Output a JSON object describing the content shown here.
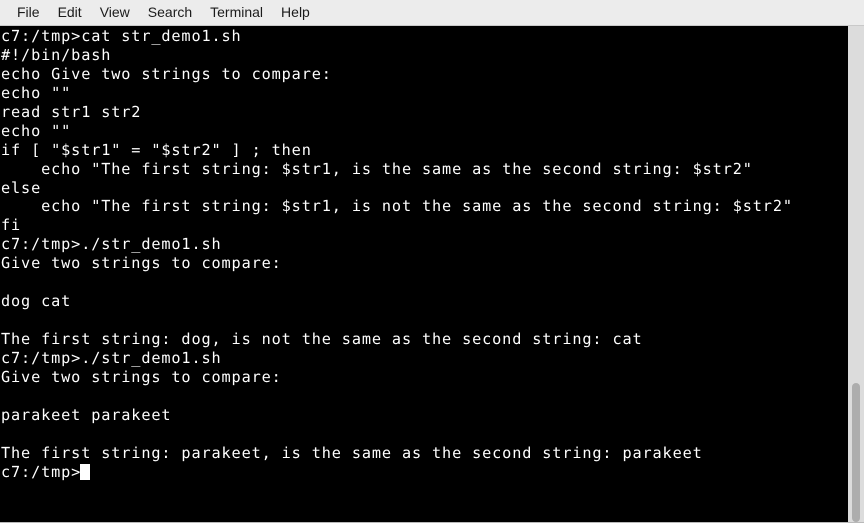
{
  "menubar": {
    "items": [
      {
        "label": "File",
        "name": "menu-file"
      },
      {
        "label": "Edit",
        "name": "menu-edit"
      },
      {
        "label": "View",
        "name": "menu-view"
      },
      {
        "label": "Search",
        "name": "menu-search"
      },
      {
        "label": "Terminal",
        "name": "menu-terminal"
      },
      {
        "label": "Help",
        "name": "menu-help"
      }
    ]
  },
  "terminal": {
    "background_color": "#000000",
    "foreground_color": "#ffffff",
    "prompt": "c7:/tmp>",
    "lines": [
      "c7:/tmp>cat str_demo1.sh",
      "#!/bin/bash",
      "echo Give two strings to compare:",
      "echo \"\"",
      "read str1 str2",
      "echo \"\"",
      "if [ \"$str1\" = \"$str2\" ] ; then",
      "    echo \"The first string: $str1, is the same as the second string: $str2\"",
      "else",
      "    echo \"The first string: $str1, is not the same as the second string: $str2\"",
      "fi",
      "c7:/tmp>./str_demo1.sh",
      "Give two strings to compare:",
      "",
      "dog cat",
      "",
      "The first string: dog, is not the same as the second string: cat",
      "c7:/tmp>./str_demo1.sh",
      "Give two strings to compare:",
      "",
      "parakeet parakeet",
      "",
      "The first string: parakeet, is the same as the second string: parakeet"
    ],
    "final_prompt": "c7:/tmp>",
    "cursor": "block"
  },
  "scrollbar": {
    "track_color": "#dcdcdc",
    "thumb_color": "#adadad",
    "thumb_top_pct": 72,
    "thumb_height_pct": 28
  }
}
